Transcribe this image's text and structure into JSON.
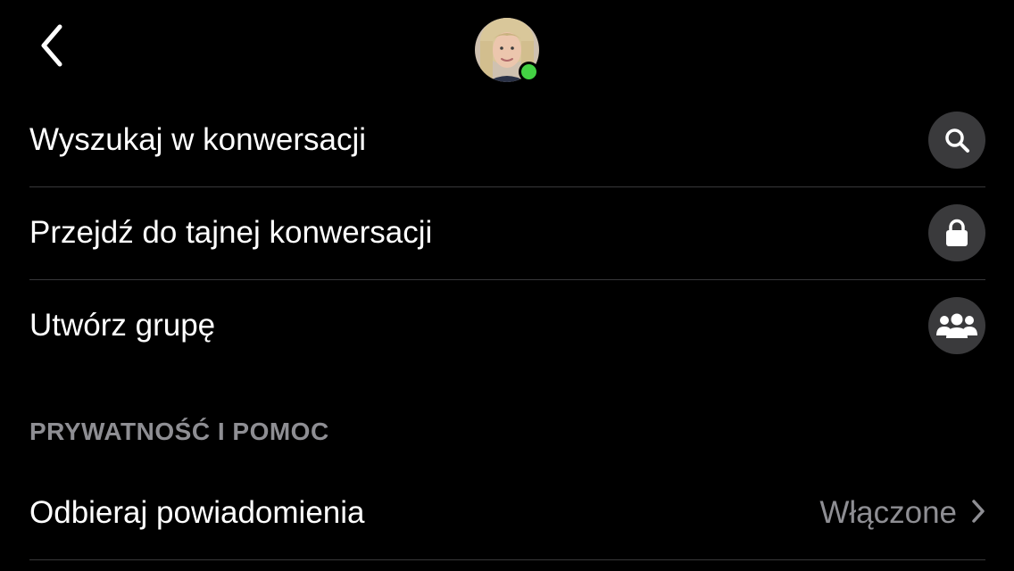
{
  "header": {
    "back_icon": "chevron-left-icon",
    "avatar": {
      "icon": "profile-avatar",
      "online": true,
      "status_color": "#44d244"
    }
  },
  "menu": {
    "items": [
      {
        "label": "Wyszukaj w konwersacji",
        "icon": "search-icon"
      },
      {
        "label": "Przejdź do tajnej konwersacji",
        "icon": "lock-icon"
      },
      {
        "label": "Utwórz grupę",
        "icon": "group-icon"
      }
    ]
  },
  "privacy_section": {
    "header": "PRYWATNOŚĆ I POMOC",
    "items": [
      {
        "label": "Odbieraj powiadomienia",
        "value": "Włączone",
        "icon": "chevron-right-icon"
      }
    ]
  },
  "colors": {
    "background": "#000000",
    "icon_circle": "#3a3a3c",
    "secondary_text": "#8e8e93",
    "divider": "#38383a"
  }
}
